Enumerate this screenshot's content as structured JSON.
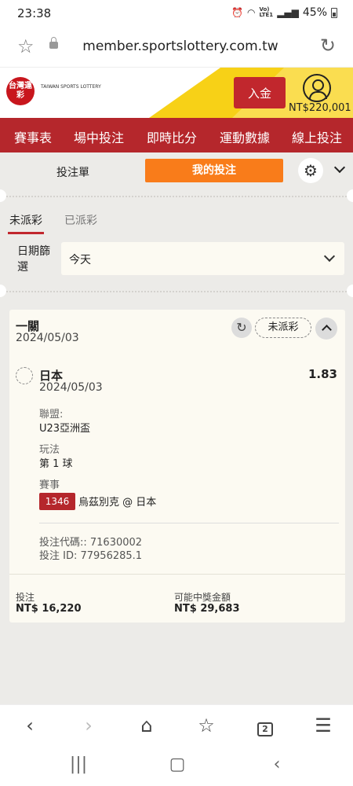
{
  "status_bar": {
    "time": "23:38",
    "battery": "45%",
    "network": "VoLTE LTE1"
  },
  "browser": {
    "url": "member.sportslottery.com.tw"
  },
  "header": {
    "logo_text": "台灣運彩",
    "logo_sub": "TAIWAN SPORTS LOTTERY",
    "deposit_label": "入金",
    "balance": "NT$220,001"
  },
  "nav": {
    "items": [
      "賽事表",
      "場中投注",
      "即時比分",
      "運動數據",
      "線上投注"
    ]
  },
  "bet_tabs": {
    "slip": "投注單",
    "my_bets": "我的投注"
  },
  "settle_tabs": {
    "unsettled": "未派彩",
    "settled": "已派彩"
  },
  "date_filter": {
    "label": "日期篩選",
    "value": "今天"
  },
  "bet_card": {
    "title": "一關",
    "date": "2024/05/03",
    "status": "未派彩",
    "selection": {
      "name": "日本",
      "date": "2024/05/03",
      "odds": "1.83",
      "league_label": "聯盟:",
      "league": "U23亞洲盃",
      "market_label": "玩法",
      "market": "第 1 球",
      "event_label": "賽事",
      "event_code": "1346",
      "event_name": "烏茲別克 @ 日本"
    },
    "bet_code": "投注代碼:: 71630002",
    "bet_id": "投注 ID: 77956285.1",
    "stake_label": "投注",
    "stake": "NT$ 16,220",
    "payout_label": "可能中獎金額",
    "payout": "NT$ 29,683"
  },
  "toolbar": {
    "tabs_count": "2"
  },
  "colors": {
    "brand_red": "#b5272c",
    "orange": "#f97c1a",
    "yellow": "#f7d117",
    "card_bg": "#fcfaf2"
  }
}
